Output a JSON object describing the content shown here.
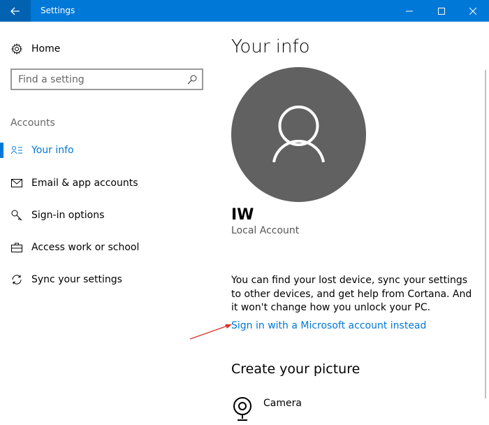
{
  "window": {
    "title": "Settings"
  },
  "sidebar": {
    "home_label": "Home",
    "search_placeholder": "Find a setting",
    "section_label": "Accounts",
    "items": [
      {
        "label": "Your info",
        "icon": "person-card-icon",
        "selected": true
      },
      {
        "label": "Email & app accounts",
        "icon": "mail-icon"
      },
      {
        "label": "Sign-in options",
        "icon": "key-icon"
      },
      {
        "label": "Access work or school",
        "icon": "briefcase-icon"
      },
      {
        "label": "Sync your settings",
        "icon": "sync-icon"
      }
    ]
  },
  "main": {
    "title": "Your info",
    "user_name": "IW",
    "account_type": "Local Account",
    "info_text": "You can find your lost device, sync your settings to other devices, and get help from Cortana. And it won't change how you unlock your PC.",
    "ms_link": "Sign in with a Microsoft account instead",
    "picture_heading": "Create your picture",
    "picture_options": [
      {
        "label": "Camera",
        "icon": "camera-icon"
      }
    ]
  },
  "colors": {
    "accent": "#0078d7",
    "avatar": "#616161",
    "annotation_arrow": "#d9322a"
  }
}
